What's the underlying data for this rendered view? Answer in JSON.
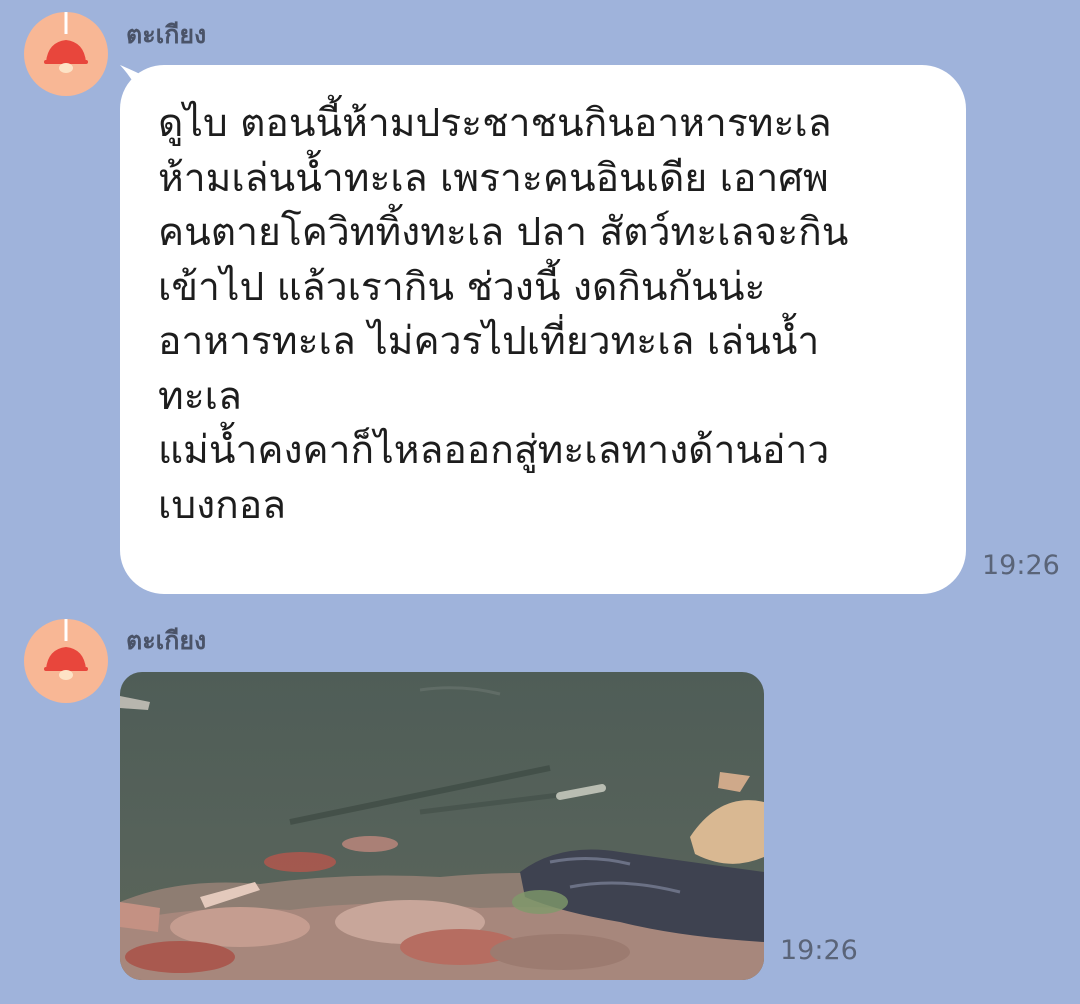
{
  "colors": {
    "chat_background": "#9fb3db",
    "bubble": "#ffffff",
    "avatar_background": "#f8b795",
    "avatar_lamp": "#e8463c",
    "sender_name": "#4a5368",
    "timestamp": "#5a6478"
  },
  "messages": [
    {
      "sender": "ตะเกียง",
      "avatar_icon": "lamp-icon",
      "type": "text",
      "text": "ดูไบ ตอนนี้ห้ามประชาชนกินอาหารทะเล\nห้ามเล่นน้ำทะเล เพราะคนอินเดีย เอาศพ\nคนตายโควิททิ้งทะเล ปลา สัตว์ทะเลจะกิน\nเข้าไป แล้วเรากิน ช่วงนี้ งดกินกันน่ะ\nอาหารทะเล ไม่ควรไปเที่ยวทะเล เล่นน้ำ\nทะเล\nแม่น้ำคงคาก็ไหลออกสู่ทะเลทางด้านอ่าว\nเบงกอล",
      "time": "19:26"
    },
    {
      "sender": "ตะเกียง",
      "avatar_icon": "lamp-icon",
      "type": "image",
      "image_description_icon": "river-photo",
      "time": "19:26"
    }
  ]
}
